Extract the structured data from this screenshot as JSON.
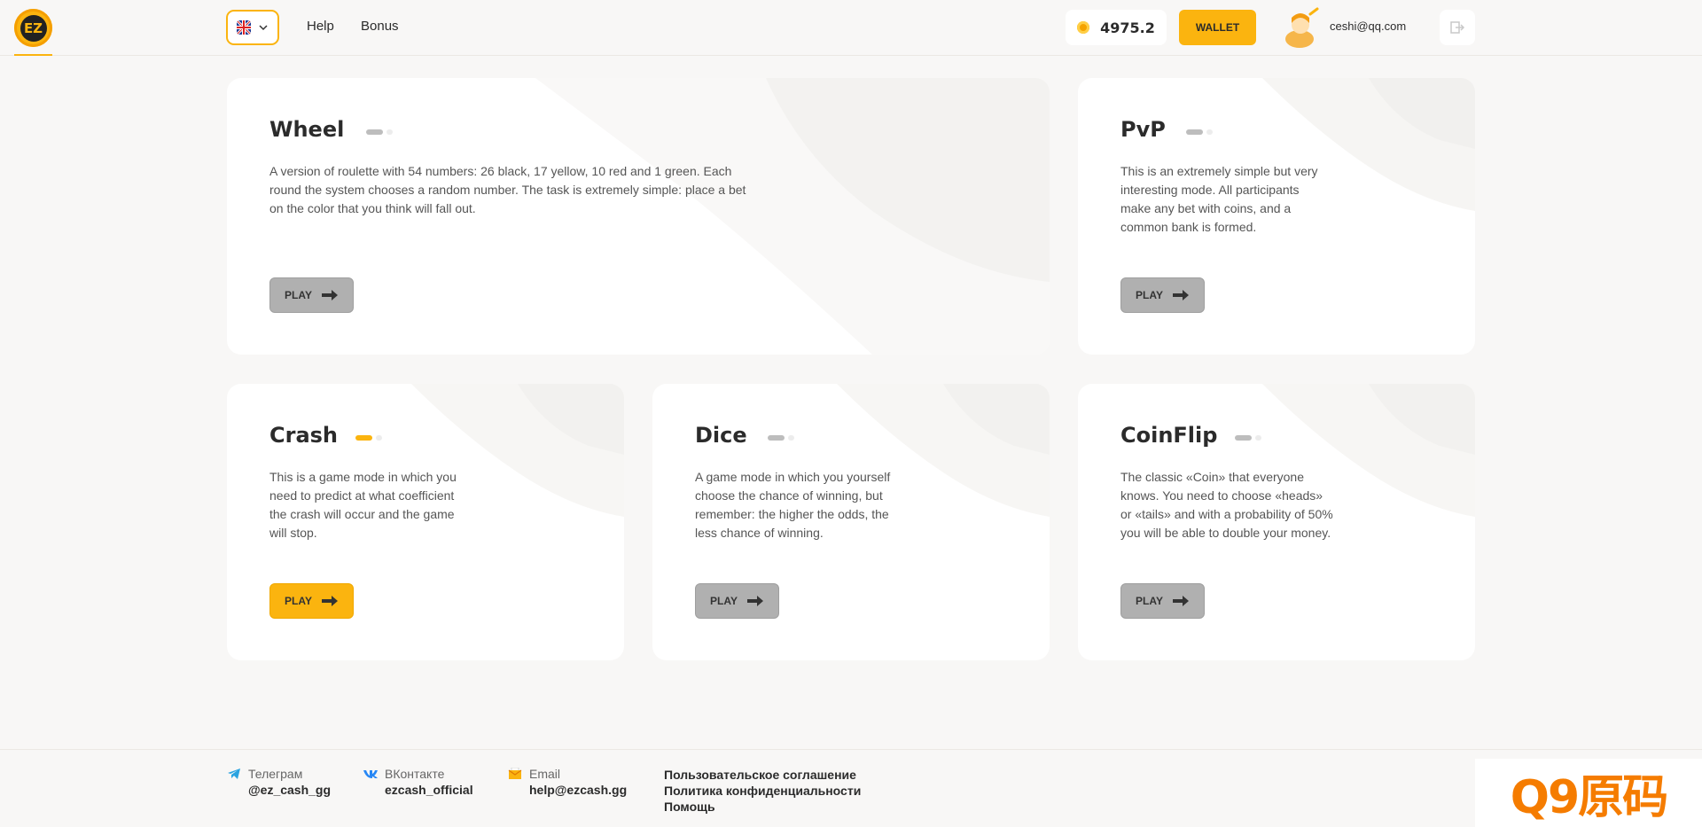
{
  "header": {
    "logo_text": "EZ",
    "nav": [
      "Help",
      "Bonus"
    ],
    "balance": "4975.2",
    "wallet_label": "WALLET",
    "user_email": "ceshi@qq.com"
  },
  "games": [
    {
      "title": "Wheel",
      "description": "A version of roulette with 54 numbers: 26 black, 17 yellow, 10 red and 1 green. Each round the system chooses a random number. The task is extremely simple: place a bet on the color that you think will fall out.",
      "play_label": "PLAY"
    },
    {
      "title": "PvP",
      "description": "This is an extremely simple but very interesting mode. All participants make any bet with coins, and a common bank is formed.",
      "play_label": "PLAY"
    },
    {
      "title": "Crash",
      "description": "This is a game mode in which you need to predict at what coefficient the crash will occur and the game will stop.",
      "play_label": "PLAY"
    },
    {
      "title": "Dice",
      "description": "A game mode in which you yourself choose the chance of winning, but remember: the higher the odds, the less chance of winning.",
      "play_label": "PLAY"
    },
    {
      "title": "CoinFlip",
      "description": "The classic «Coin» that everyone knows. You need to choose «heads» or «tails» and with a probability of 50% you will be able to double your money.",
      "play_label": "PLAY"
    }
  ],
  "footer": {
    "telegram": {
      "label": "Телеграм",
      "value": "@ez_cash_gg"
    },
    "vk": {
      "label": "ВКонтакте",
      "value": "ezcash_official"
    },
    "email": {
      "label": "Email",
      "value": "help@ezcash.gg"
    },
    "links": [
      "Пользовательское соглашение",
      "Политика конфиденциальности",
      "Помощь"
    ]
  },
  "watermark": "Q9原码",
  "colors": {
    "accent": "#fbb40f",
    "button_inactive": "#b0b0b0",
    "background": "#f8f7f6"
  }
}
